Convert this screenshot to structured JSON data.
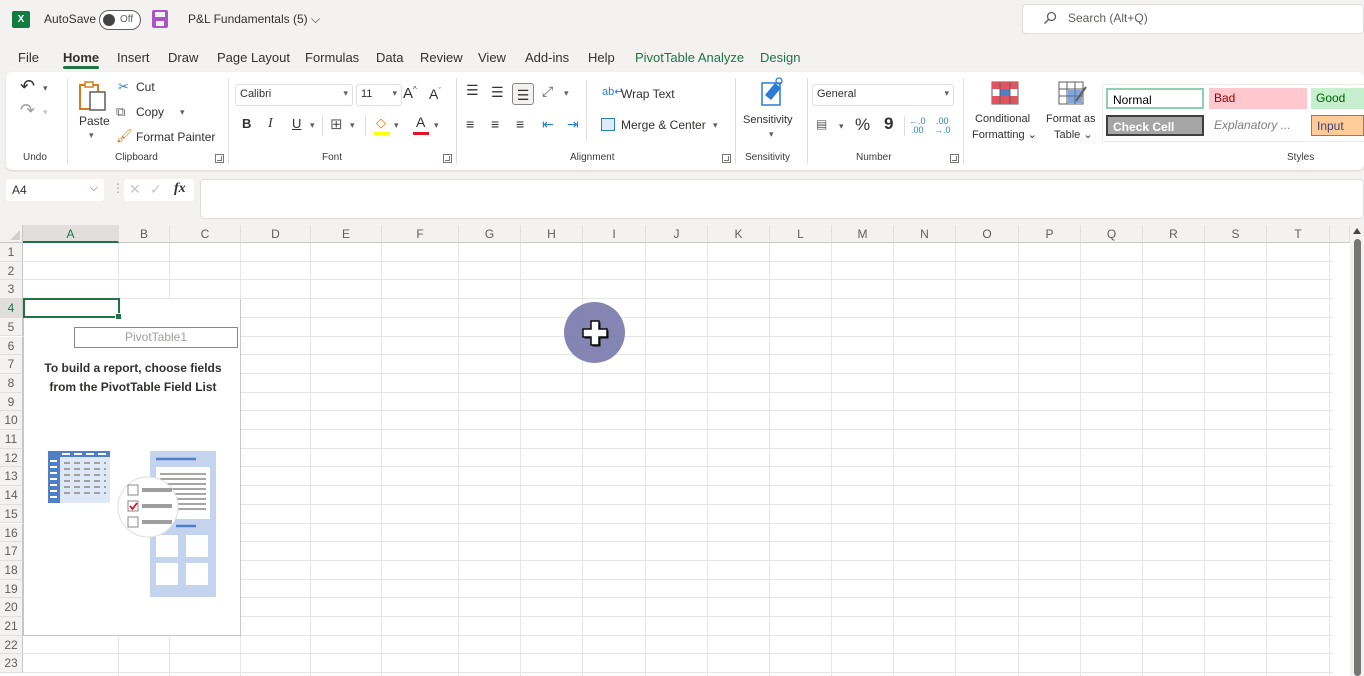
{
  "titlebar": {
    "app_icon": "excel-logo-icon",
    "app_icon_letter": "X",
    "autosave_label": "AutoSave",
    "autosave_state": "Off",
    "save_icon": "save-icon",
    "document_title": "P&L Fundamentals (5)",
    "title_caret": "⌵",
    "search_placeholder": "Search (Alt+Q)",
    "search_icon": "⚲"
  },
  "tabs": [
    {
      "label": "File"
    },
    {
      "label": "Home",
      "active": true
    },
    {
      "label": "Insert"
    },
    {
      "label": "Draw"
    },
    {
      "label": "Page Layout"
    },
    {
      "label": "Formulas"
    },
    {
      "label": "Data"
    },
    {
      "label": "Review"
    },
    {
      "label": "View"
    },
    {
      "label": "Add-ins"
    },
    {
      "label": "Help"
    },
    {
      "label": "PivotTable Analyze",
      "contextual": true
    },
    {
      "label": "Design",
      "contextual": true
    }
  ],
  "ribbon": {
    "undo": {
      "group_label": "Undo",
      "undo_glyph": "↶",
      "redo_glyph": "↷"
    },
    "clipboard": {
      "group_label": "Clipboard",
      "paste": "Paste",
      "cut": "Cut",
      "copy": "Copy",
      "format_painter": "Format Painter"
    },
    "font": {
      "group_label": "Font",
      "font_name": "Calibri",
      "font_size": "11",
      "grow": "A",
      "shrink": "A",
      "bold": "B",
      "italic": "I",
      "underline": "U",
      "font_color_letter": "A",
      "fill_color": "#ffff00",
      "font_color": "#e81123"
    },
    "alignment": {
      "group_label": "Alignment",
      "wrap_text": "Wrap Text",
      "merge_center": "Merge & Center"
    },
    "sensitivity": {
      "group_label": "Sensitivity",
      "button": "Sensitivity"
    },
    "number": {
      "group_label": "Number",
      "format": "General",
      "percent": "%",
      "comma": "9",
      "inc_decimal": "←.0 .00",
      "dec_decimal": ".00 →.0"
    },
    "styles": {
      "group_label": "Styles",
      "conditional_formatting": [
        "Conditional",
        "Formatting ⌄"
      ],
      "format_as_table": [
        "Format as",
        "Table ⌄"
      ],
      "cells": [
        {
          "label": "Normal",
          "bg": "#ffffff",
          "fg": "#000000",
          "border": "#8fd0b0"
        },
        {
          "label": "Bad",
          "bg": "#ffc7ce",
          "fg": "#9c0006"
        },
        {
          "label": "Good",
          "bg": "#c6efce",
          "fg": "#006100"
        },
        {
          "label": "Check Cell",
          "bg": "#a5a5a5",
          "fg": "#ffffff",
          "border": "#3f3f3f"
        },
        {
          "label": "Explanatory ...",
          "bg": "#ffffff",
          "fg": "#7f7f7f"
        },
        {
          "label": "Input",
          "bg": "#ffcc99",
          "fg": "#3f3f76"
        }
      ]
    }
  },
  "formula_bar": {
    "name_box": "A4",
    "cancel": "✕",
    "enter": "✓",
    "fx": "fx",
    "formula": ""
  },
  "grid": {
    "columns": [
      "A",
      "B",
      "C",
      "D",
      "E",
      "F",
      "G",
      "H",
      "I",
      "J",
      "K",
      "L",
      "M",
      "N",
      "O",
      "P",
      "Q",
      "R",
      "S",
      "T"
    ],
    "rows": [
      "1",
      "2",
      "3",
      "4",
      "5",
      "6",
      "7",
      "8",
      "9",
      "10",
      "11",
      "12",
      "13",
      "14",
      "15",
      "16",
      "17",
      "18",
      "19",
      "20",
      "21",
      "22",
      "23"
    ],
    "active_cell": "A4",
    "selected_column": "A",
    "selected_row": "4"
  },
  "pivot": {
    "name": "PivotTable1",
    "message_line1": "To build a report, choose fields",
    "message_line2": "from the PivotTable Field List"
  },
  "colors": {
    "accent": "#217346",
    "pivot_illustration": "#4f7fc6",
    "pivot_panel": "#c5d4ee",
    "cursor_badge": "#7f7fb0"
  }
}
